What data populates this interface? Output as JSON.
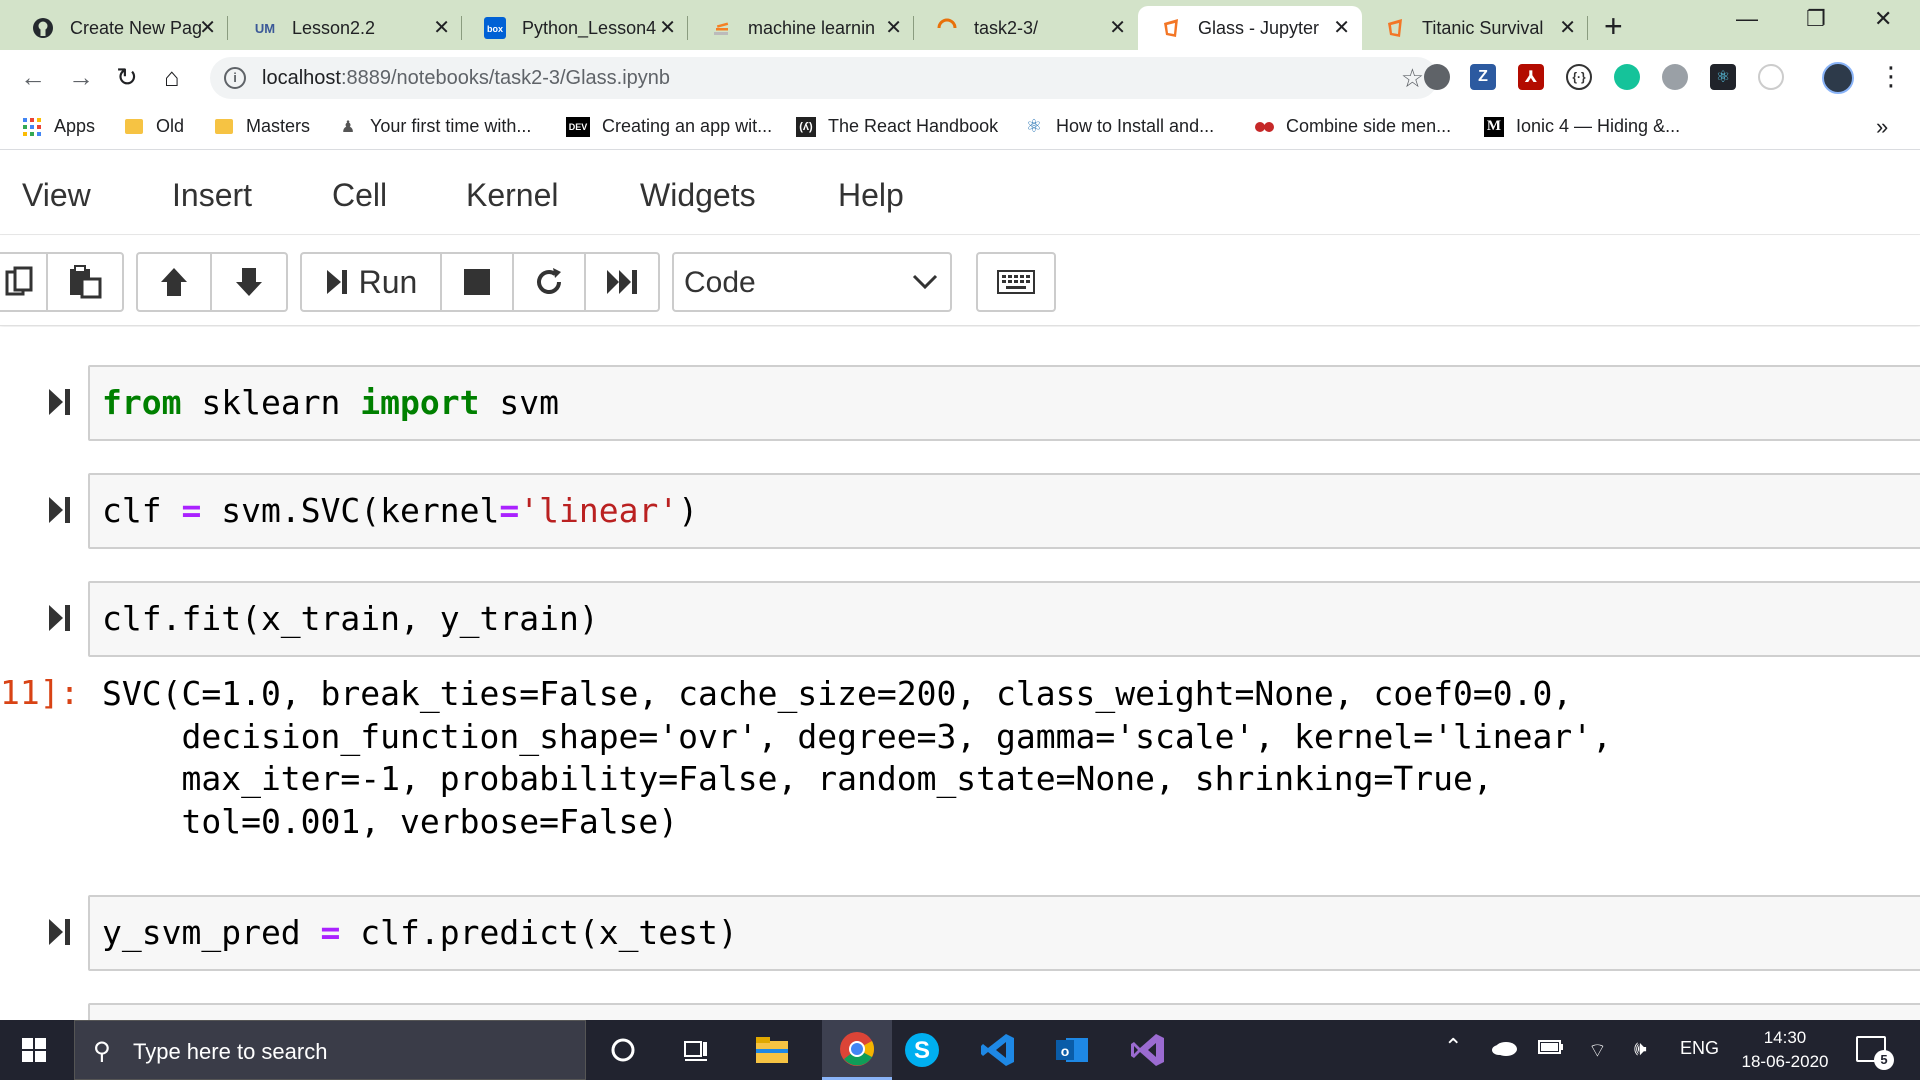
{
  "browser": {
    "tabs": [
      {
        "title": "Create New Pag",
        "icon": "github-icon"
      },
      {
        "title": "Lesson2.2",
        "icon": "unacademy-icon"
      },
      {
        "title": "Python_Lesson4",
        "icon": "box-icon"
      },
      {
        "title": "machine learnin",
        "icon": "stackoverflow-icon"
      },
      {
        "title": "task2-3/",
        "icon": "loading-icon"
      },
      {
        "title": "Glass - Jupyter N",
        "icon": "jupyter-icon",
        "active": true
      },
      {
        "title": "Titanic Survival",
        "icon": "jupyter-icon"
      }
    ],
    "new_tab": "+",
    "window_controls": {
      "minimize": "—",
      "restore": "❐",
      "close": "✕"
    },
    "address": {
      "host": "localhost",
      "path": ":8889/notebooks/task2-3/Glass.ipynb"
    },
    "bookmarks": [
      {
        "label": "Apps",
        "icon": "apps-grid-icon"
      },
      {
        "label": "Old",
        "icon": "folder-icon"
      },
      {
        "label": "Masters",
        "icon": "folder-icon"
      },
      {
        "label": "Your first time with...",
        "icon": "bookmark-icon"
      },
      {
        "label": "Creating an app wit...",
        "icon": "dev-icon",
        "badge": "DEV"
      },
      {
        "label": "The React Handbook",
        "icon": "react-handbook-icon"
      },
      {
        "label": "How to Install and...",
        "icon": "react-icon"
      },
      {
        "label": "Combine side men...",
        "icon": "bookmark-icon"
      },
      {
        "label": "Ionic 4 — Hiding &...",
        "icon": "medium-icon",
        "badge": "M"
      }
    ],
    "bookmarks_more": "»",
    "colors": {
      "tabstrip": "#d3e3c9",
      "active_tab": "#ffffff"
    }
  },
  "jupyter": {
    "menu": [
      "View",
      "Insert",
      "Cell",
      "Kernel",
      "Widgets",
      "Help"
    ],
    "toolbar": {
      "run_label": "Run",
      "cell_type": "Code"
    },
    "cells": [
      {
        "tokens": [
          {
            "t": "from",
            "c": "kw"
          },
          {
            "t": " sklearn ",
            "c": ""
          },
          {
            "t": "import",
            "c": "kw"
          },
          {
            "t": " svm",
            "c": ""
          }
        ]
      },
      {
        "tokens": [
          {
            "t": "clf ",
            "c": ""
          },
          {
            "t": "=",
            "c": "op"
          },
          {
            "t": " svm.SVC(kernel",
            "c": ""
          },
          {
            "t": "=",
            "c": "op"
          },
          {
            "t": "'linear'",
            "c": "str"
          },
          {
            "t": ")",
            "c": ""
          }
        ]
      },
      {
        "tokens": [
          {
            "t": "clf.fit(x_train, y_train)",
            "c": ""
          }
        ]
      },
      {
        "tokens": [
          {
            "t": "y_svm_pred ",
            "c": ""
          },
          {
            "t": "=",
            "c": "op"
          },
          {
            "t": " clf.predict(x_test)",
            "c": ""
          }
        ]
      }
    ],
    "output": {
      "prompt": "11]:",
      "lines": [
        "SVC(C=1.0, break_ties=False, cache_size=200, class_weight=None, coef0=0.0,",
        "    decision_function_shape='ovr', degree=3, gamma='scale', kernel='linear',",
        "    max_iter=-1, probability=False, random_state=None, shrinking=True,",
        "    tol=0.001, verbose=False)"
      ]
    },
    "colors": {
      "keyword": "#008000",
      "operator": "#aa22ff",
      "string": "#ba2121",
      "out_prompt": "#d84315"
    }
  },
  "taskbar": {
    "search_placeholder": "Type here to search",
    "apps": [
      "cortana-icon",
      "task-view-icon",
      "file-explorer-icon",
      "chrome-icon",
      "skype-icon",
      "vscode-icon",
      "outlook-icon",
      "visual-studio-icon"
    ],
    "language": "ENG",
    "time": "14:30",
    "date": "18-06-2020",
    "notification_count": "5"
  }
}
